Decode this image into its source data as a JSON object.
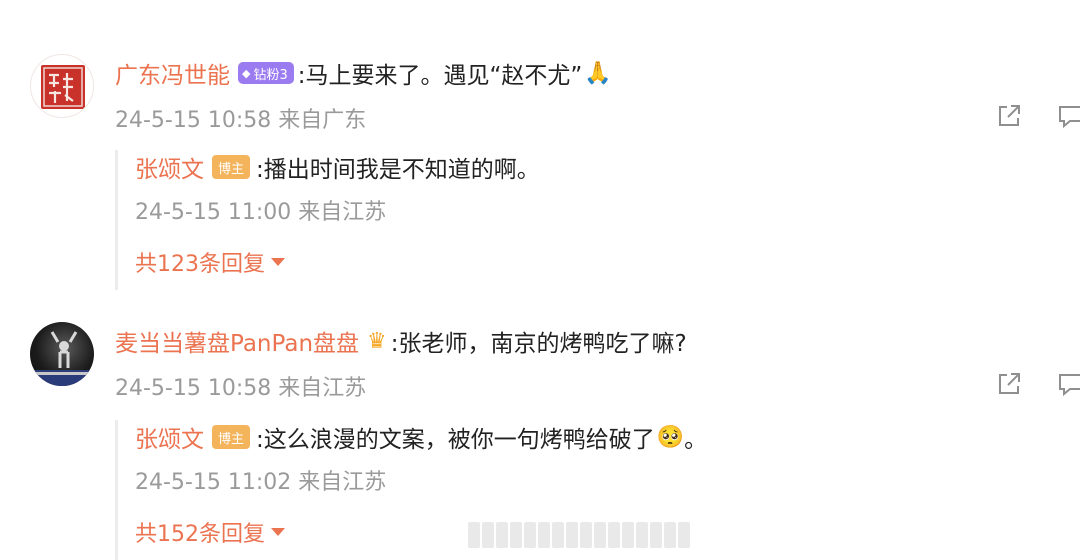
{
  "comments": [
    {
      "user": "广东冯世能",
      "fan_badge": "钻粉3",
      "text": ":马上要来了。遇见“赵不尤”",
      "emoji": "🙏",
      "meta": "24-5-15 10:58 来自广东",
      "reply": {
        "user": "张颂文",
        "badge": "博主",
        "text": ":播出时间我是不知道的啊。",
        "meta": "24-5-15 11:00 来自江苏",
        "more": "共123条回复"
      }
    },
    {
      "user": "麦当当薯盘PanPan盘盘",
      "text": ":张老师，南京的烤鸭吃了嘛?",
      "meta": "24-5-15 10:58 来自江苏",
      "reply": {
        "user": "张颂文",
        "badge": "博主",
        "text": ":这么浪漫的文案，被你一句烤鸭给破了",
        "emoji": "🥺",
        "tail": "。",
        "meta": "24-5-15 11:02 来自江苏",
        "more": "共152条回复"
      }
    }
  ],
  "icons": {
    "seal_avatar": "seal-avatar",
    "photo_avatar": "photo-avatar",
    "fan_badge_icon": "diamond-icon",
    "crown_icon": "crown-icon",
    "share_icon": "share-icon",
    "comment_icon": "comment-icon",
    "more_caret": "chevron-down-icon"
  },
  "colors": {
    "username": "#eb7350",
    "meta": "#9a9a9a",
    "fan_badge": "#9b7cf0",
    "host_badge": "#f3b45c"
  }
}
